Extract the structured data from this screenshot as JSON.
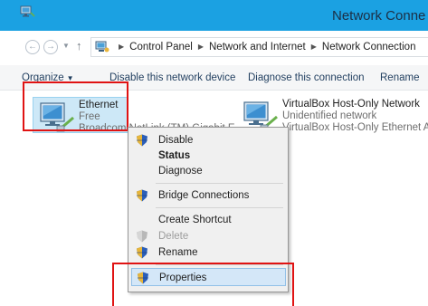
{
  "window": {
    "title": "Network Conne",
    "app_icon": "network-connections-icon"
  },
  "address_bar": {
    "back_icon": "back-arrow-icon",
    "forward_icon": "forward-arrow-icon",
    "recent_icon": "chevron-down-icon",
    "up_icon": "up-arrow-icon",
    "location_icon": "control-panel-icon",
    "breadcrumbs": [
      "Control Panel",
      "Network and Internet",
      "Network Connection"
    ]
  },
  "toolbar": {
    "organize_label": "Organize",
    "disable_label": "Disable this network device",
    "diagnose_label": "Diagnose this connection",
    "rename_label": "Rename"
  },
  "adapters": [
    {
      "name": "Ethernet",
      "status": "Free",
      "device": "Broadcom NetLink (TM) Gigabit E",
      "selected": true
    },
    {
      "name": "VirtualBox Host-Only Network",
      "status": "Unidentified network",
      "device": "VirtualBox Host-Only Ethernet A",
      "selected": false
    }
  ],
  "context_menu": {
    "items": [
      {
        "label": "Disable",
        "icon": "shield-icon"
      },
      {
        "label": "Status",
        "bold": true
      },
      {
        "label": "Diagnose"
      },
      {
        "label": "Bridge Connections",
        "icon": "shield-icon"
      },
      {
        "label": "Create Shortcut"
      },
      {
        "label": "Delete",
        "icon": "shield-icon",
        "disabled": true
      },
      {
        "label": "Rename",
        "icon": "shield-icon"
      },
      {
        "label": "Properties",
        "icon": "shield-icon",
        "selected": true
      }
    ]
  },
  "colors": {
    "title_bar": "#1ba1e2",
    "highlight_box": "#e01313",
    "selection": "#cde8f7",
    "menu_hover": "#d4e7f8"
  }
}
